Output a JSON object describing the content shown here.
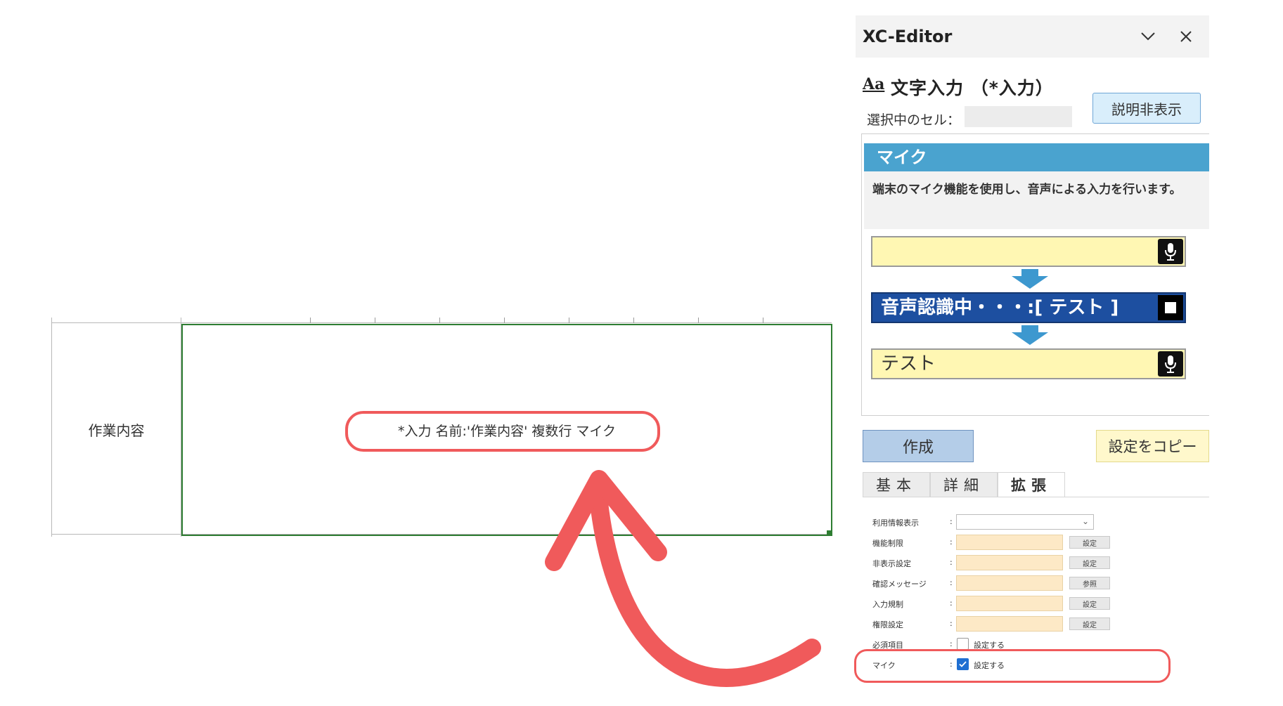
{
  "sheet": {
    "label_cell": "作業内容",
    "selected_cell": "*入力 名前:'作業内容' 複数行 マイク"
  },
  "editor": {
    "title": "XC-Editor",
    "heading_icon": "Aa",
    "heading": "文字入力 （*入力）",
    "hide_description_button": "説明非表示",
    "selected_cell_label": "選択中のセル：",
    "selected_cell_value": "",
    "help": {
      "heading": "マイク",
      "description": "端末のマイク機能を使用し、音声による入力を行います。",
      "demo_recognizing": "音声認識中・・・:[ テスト ]",
      "demo_result": "テスト"
    },
    "create_button": "作成",
    "copy_button": "設定をコピー",
    "tabs": [
      "基本",
      "詳細",
      "拡張"
    ],
    "active_tab": "拡張",
    "properties": [
      {
        "label": "利用情報表示",
        "control": "select",
        "value": ""
      },
      {
        "label": "機能制限",
        "control": "field",
        "button": "設定"
      },
      {
        "label": "非表示設定",
        "control": "field",
        "button": "設定"
      },
      {
        "label": "確認メッセージ",
        "control": "field",
        "button": "参照"
      },
      {
        "label": "入力規制",
        "control": "field",
        "button": "設定"
      },
      {
        "label": "権限設定",
        "control": "field",
        "button": "設定"
      },
      {
        "label": "必須項目",
        "control": "checkbox",
        "checked": false,
        "checkbox_label": "設定する"
      },
      {
        "label": "マイク",
        "control": "checkbox",
        "checked": true,
        "checkbox_label": "設定する"
      }
    ],
    "colors": {
      "help_header": "#4aa3cf",
      "recognizing_bg": "#1d4fa0",
      "demo_field": "#fff7b3",
      "highlight": "#f05a5b",
      "selection_border": "#2e7d32"
    }
  }
}
